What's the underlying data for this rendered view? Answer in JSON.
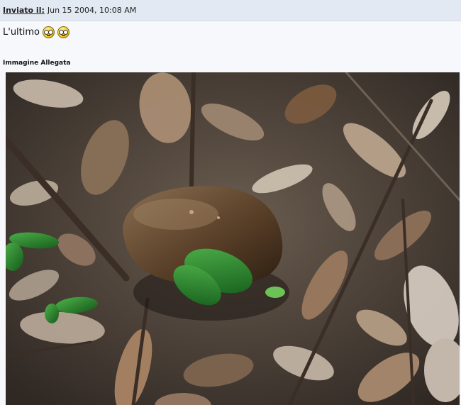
{
  "post": {
    "posted_label": "Inviato il:",
    "posted_date": "Jun 15 2004, 10:08 AM",
    "message_text": "L'ultimo",
    "smileys": [
      "smiley-icon",
      "smiley-icon"
    ]
  },
  "attachment": {
    "heading": "Immagine Allegata",
    "image_subject": "mushroom-among-leaves-photo"
  },
  "colors": {
    "header_bg": "#e3e9f2",
    "body_bg": "#f6f8fb"
  }
}
